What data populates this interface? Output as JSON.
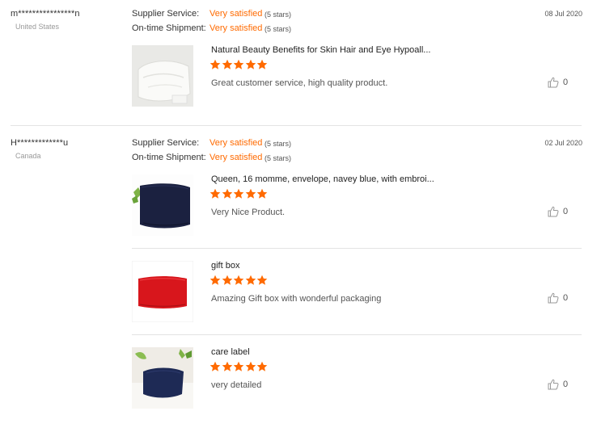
{
  "labels": {
    "supplier_service": "Supplier Service:",
    "ontime_shipment": "On-time Shipment:"
  },
  "reviews": [
    {
      "buyer": "m****************n",
      "country": "United States",
      "date": "08 Jul 2020",
      "supplier_service": "Very satisfied",
      "supplier_stars": "(5 stars)",
      "ontime_shipment": "Very satisfied",
      "ontime_stars": "(5 stars)",
      "products": [
        {
          "title": "Natural Beauty Benefits for Skin Hair and Eye Hypoall...",
          "rating": 5,
          "feedback": "Great customer service, high quality product.",
          "helpful": "0",
          "thumb_icon": "white-pillowcase-image",
          "color": "#f4f4f2"
        }
      ]
    },
    {
      "buyer": "H*************u",
      "country": "Canada",
      "date": "02 Jul 2020",
      "supplier_service": "Very satisfied",
      "supplier_stars": "(5 stars)",
      "ontime_shipment": "Very satisfied",
      "ontime_stars": "(5 stars)",
      "products": [
        {
          "title": "Queen, 16 momme, envelope, navey blue, with embroi...",
          "rating": 5,
          "feedback": "Very Nice Product.",
          "helpful": "0",
          "thumb_icon": "navy-pillowcase-image",
          "color": "#1b2140"
        },
        {
          "title": "gift box",
          "rating": 5,
          "feedback": "Amazing Gift box with wonderful packaging",
          "helpful": "0",
          "thumb_icon": "red-pillowcase-image",
          "color": "#d8161c"
        },
        {
          "title": "care label",
          "rating": 5,
          "feedback": "very detailed",
          "helpful": "0",
          "thumb_icon": "navy-pillow-on-bed-image",
          "color": "#1e2a55"
        }
      ]
    }
  ],
  "colors": {
    "accent": "#ff6a00",
    "divider": "#e3e3e3"
  }
}
